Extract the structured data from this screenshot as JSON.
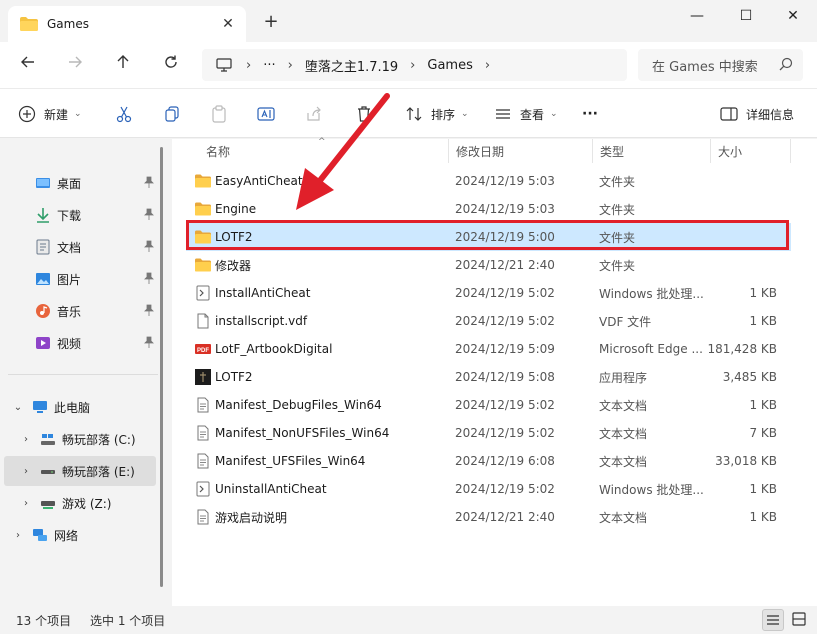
{
  "window": {
    "tab_title": "Games",
    "minimize_glyph": "—",
    "maximize_glyph": "☐",
    "close_glyph": "✕",
    "new_tab_glyph": "+"
  },
  "address": {
    "ellipsis": "···",
    "crumbs": [
      "堕落之主1.7.19",
      "Games"
    ],
    "search_placeholder": "在 Games 中搜索"
  },
  "toolbar": {
    "new_label": "新建",
    "sort_label": "排序",
    "view_label": "查看",
    "more_label": "···",
    "details_label": "详细信息"
  },
  "sidebar": {
    "quick_access": [
      {
        "label": "桌面",
        "icon": "desktop-icon"
      },
      {
        "label": "下载",
        "icon": "download-icon"
      },
      {
        "label": "文档",
        "icon": "document-icon"
      },
      {
        "label": "图片",
        "icon": "pictures-icon"
      },
      {
        "label": "音乐",
        "icon": "music-icon"
      },
      {
        "label": "视频",
        "icon": "video-icon"
      }
    ],
    "this_pc": "此电脑",
    "drives": [
      {
        "label": "畅玩部落 (C:)"
      },
      {
        "label": "畅玩部落 (E:)"
      },
      {
        "label": "游戏 (Z:)"
      }
    ],
    "network": "网络"
  },
  "columns": {
    "name": "名称",
    "date": "修改日期",
    "type": "类型",
    "size": "大小"
  },
  "files": [
    {
      "name": "EasyAntiCheat",
      "date": "2024/12/19 5:03",
      "type": "文件夹",
      "size": "",
      "icon": "folder-icon"
    },
    {
      "name": "Engine",
      "date": "2024/12/19 5:03",
      "type": "文件夹",
      "size": "",
      "icon": "folder-icon"
    },
    {
      "name": "LOTF2",
      "date": "2024/12/19 5:00",
      "type": "文件夹",
      "size": "",
      "icon": "folder-icon"
    },
    {
      "name": "修改器",
      "date": "2024/12/21 2:40",
      "type": "文件夹",
      "size": "",
      "icon": "folder-icon"
    },
    {
      "name": "InstallAntiCheat",
      "date": "2024/12/19 5:02",
      "type": "Windows 批处理...",
      "size": "1 KB",
      "icon": "batch-file-icon"
    },
    {
      "name": "installscript.vdf",
      "date": "2024/12/19 5:02",
      "type": "VDF 文件",
      "size": "1 KB",
      "icon": "file-icon"
    },
    {
      "name": "LotF_ArtbookDigital",
      "date": "2024/12/19 5:09",
      "type": "Microsoft Edge ...",
      "size": "181,428 KB",
      "icon": "pdf-icon"
    },
    {
      "name": "LOTF2",
      "date": "2024/12/19 5:08",
      "type": "应用程序",
      "size": "3,485 KB",
      "icon": "app-icon"
    },
    {
      "name": "Manifest_DebugFiles_Win64",
      "date": "2024/12/19 5:02",
      "type": "文本文档",
      "size": "1 KB",
      "icon": "text-file-icon"
    },
    {
      "name": "Manifest_NonUFSFiles_Win64",
      "date": "2024/12/19 5:02",
      "type": "文本文档",
      "size": "7 KB",
      "icon": "text-file-icon"
    },
    {
      "name": "Manifest_UFSFiles_Win64",
      "date": "2024/12/19 6:08",
      "type": "文本文档",
      "size": "33,018 KB",
      "icon": "text-file-icon"
    },
    {
      "name": "UninstallAntiCheat",
      "date": "2024/12/19 5:02",
      "type": "Windows 批处理...",
      "size": "1 KB",
      "icon": "batch-file-icon"
    },
    {
      "name": "游戏启动说明",
      "date": "2024/12/21 2:40",
      "type": "文本文档",
      "size": "1 KB",
      "icon": "text-file-icon"
    }
  ],
  "status": {
    "count": "13 个项目",
    "selected": "选中 1 个项目"
  },
  "colors": {
    "selection": "#cde8ff",
    "highlight_red": "#e0202a",
    "folder_yellow": "#f5c342"
  }
}
